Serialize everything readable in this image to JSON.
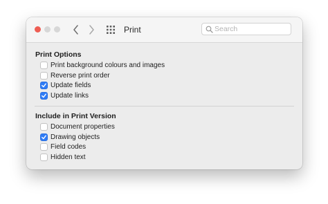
{
  "window": {
    "title": "Print",
    "traffic_lights": {
      "close": "#ee5d53",
      "minimize": "#d7d7d7",
      "zoom": "#d7d7d7"
    },
    "toolbar_icons": [
      "chevron-left-icon",
      "chevron-right-icon",
      "grid-icon",
      "search-icon"
    ],
    "accent_color": "#2f7cf6"
  },
  "search": {
    "value": "",
    "placeholder": "Search"
  },
  "sections": [
    {
      "title": "Print Options",
      "options": [
        {
          "label": "Print background colours and images",
          "checked": false
        },
        {
          "label": "Reverse print order",
          "checked": false
        },
        {
          "label": "Update fields",
          "checked": true
        },
        {
          "label": "Update links",
          "checked": true
        }
      ]
    },
    {
      "title": "Include in Print Version",
      "options": [
        {
          "label": "Document properties",
          "checked": false
        },
        {
          "label": "Drawing objects",
          "checked": true
        },
        {
          "label": "Field codes",
          "checked": false
        },
        {
          "label": "Hidden text",
          "checked": false
        }
      ]
    }
  ]
}
